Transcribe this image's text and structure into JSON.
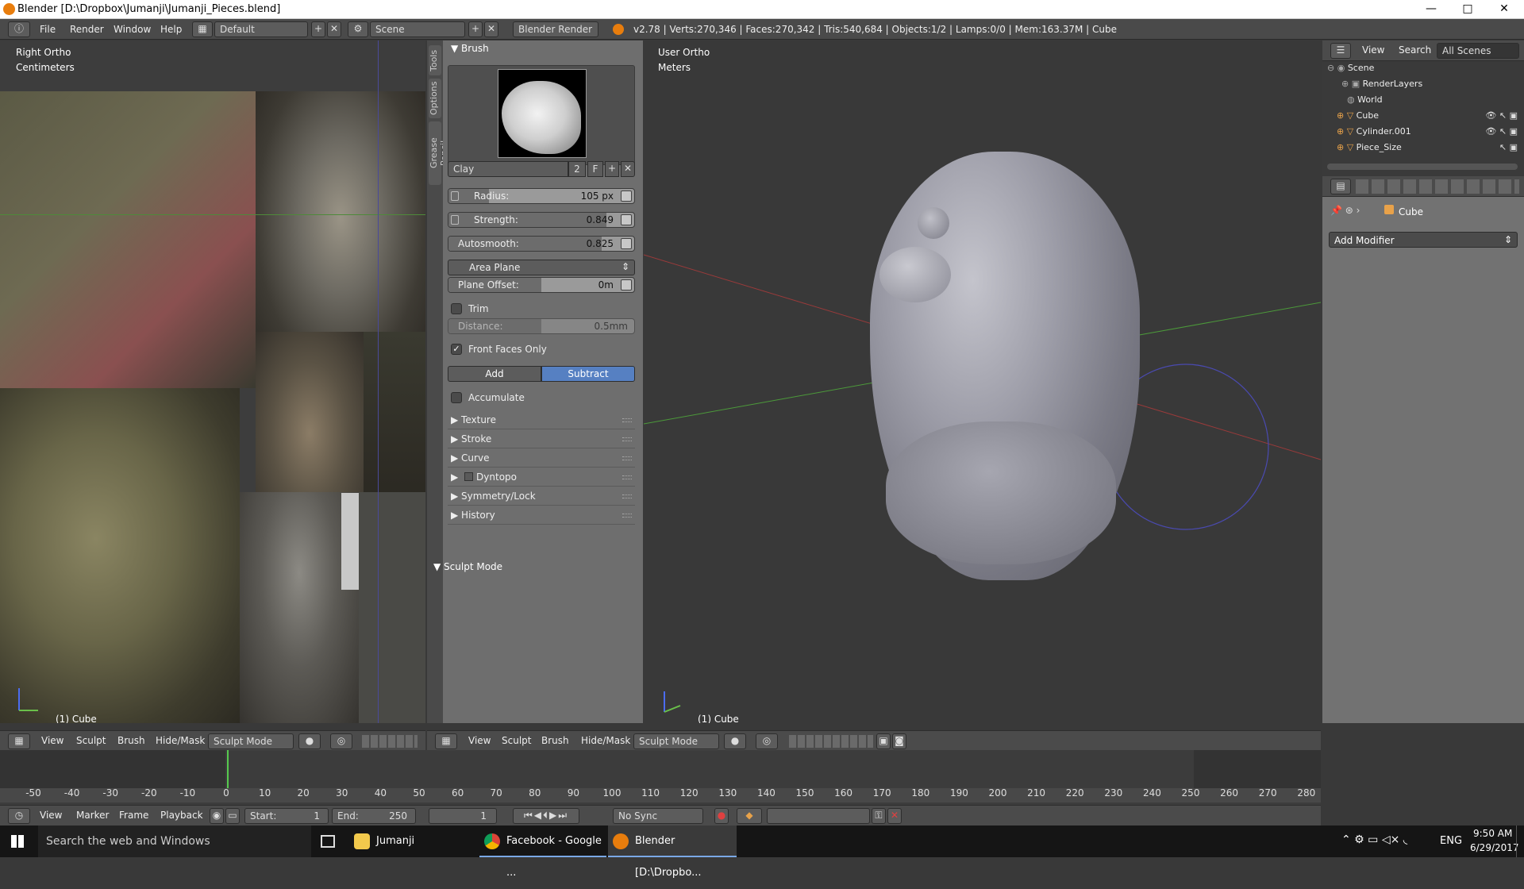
{
  "window": {
    "title": "Blender [D:\\Dropbox\\Jumanji\\Jumanji_Pieces.blend]",
    "min": "—",
    "max": "□",
    "close": "✕"
  },
  "info": {
    "menus": [
      "File",
      "Render",
      "Window",
      "Help"
    ],
    "layout": "Default",
    "scene": "Scene",
    "engine": "Blender Render",
    "stats": "v2.78 | Verts:270,346 | Faces:270,342 | Tris:540,684 | Objects:1/2 | Lamps:0/0 | Mem:163.37M | Cube"
  },
  "left_view": {
    "view_name": "Right Ortho",
    "units": "Centimeters",
    "object": "(1) Cube"
  },
  "tool_tabs": [
    "Tools",
    "Options",
    "Grease Pencil"
  ],
  "brush_panel": {
    "title": "Brush",
    "brush_name": "Clay",
    "users": "2",
    "fake": "F",
    "radius": {
      "label": "Radius:",
      "value": "105 px",
      "fraction": 0.22
    },
    "strength": {
      "label": "Strength:",
      "value": "0.849",
      "fraction": 0.849
    },
    "autosmooth": {
      "label": "Autosmooth:",
      "value": "0.825",
      "fraction": 0.825
    },
    "plane_type": "Area Plane",
    "plane_offset": {
      "label": "Plane Offset:",
      "value": "0m",
      "fraction": 0.5
    },
    "trim": "Trim",
    "distance": {
      "label": "Distance:",
      "value": "0.5mm",
      "fraction": 0.5
    },
    "front_faces": "Front Faces Only",
    "add": "Add",
    "subtract": "Subtract",
    "accumulate": "Accumulate",
    "sections": [
      "Texture",
      "Stroke",
      "Curve",
      "Dyntopo",
      "Symmetry/Lock",
      "History"
    ],
    "sculpt_mode": "Sculpt Mode"
  },
  "main_view": {
    "view_name": "User Ortho",
    "units": "Meters",
    "object": "(1) Cube"
  },
  "outliner": {
    "menus": [
      "View",
      "Search"
    ],
    "filter": "All Scenes",
    "items": [
      {
        "name": "Scene"
      },
      {
        "name": "RenderLayers"
      },
      {
        "name": "World"
      },
      {
        "name": "Cube"
      },
      {
        "name": "Cylinder.001"
      },
      {
        "name": "Piece_Size"
      }
    ]
  },
  "properties": {
    "object": "Cube",
    "add_modifier": "Add Modifier"
  },
  "view3d_header": {
    "menus": [
      "View",
      "Sculpt",
      "Brush",
      "Hide/Mask"
    ],
    "mode": "Sculpt Mode"
  },
  "timeline": {
    "ticks": [
      "-50",
      "-40",
      "-30",
      "-20",
      "-10",
      "0",
      "10",
      "20",
      "30",
      "40",
      "50",
      "60",
      "70",
      "80",
      "90",
      "100",
      "110",
      "120",
      "130",
      "140",
      "150",
      "160",
      "170",
      "180",
      "190",
      "200",
      "210",
      "220",
      "230",
      "240",
      "250",
      "260",
      "270",
      "280"
    ],
    "menus": [
      "View",
      "Marker",
      "Frame",
      "Playback"
    ],
    "start_label": "Start:",
    "start": "1",
    "end_label": "End:",
    "end": "250",
    "current": "1",
    "sync": "No Sync"
  },
  "taskbar": {
    "search": "Search the web and Windows",
    "apps": [
      "Jumanji",
      "Facebook - Google ...",
      "Blender [D:\\Dropbo..."
    ],
    "lang": "ENG",
    "time": "9:50 AM",
    "date": "6/29/2017"
  }
}
